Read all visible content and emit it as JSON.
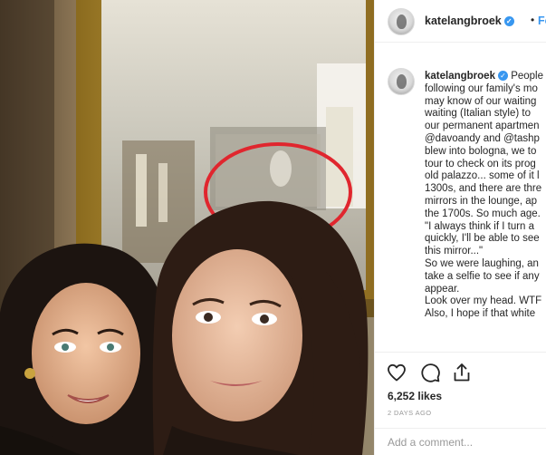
{
  "post": {
    "username": "katelangbroek",
    "follow_label": "Follo",
    "header_separator": "•",
    "verified_glyph": "✓",
    "caption_lines": [
      "People",
      "following our family's mo",
      "may know of our waiting",
      "waiting (Italian style) to",
      "our permanent apartmen",
      "@davoandy and @tashp",
      "blew into bologna, we to",
      "tour to check on its prog",
      "old palazzo... some of it l",
      "1300s, and there are thre",
      "mirrors in the lounge, ap",
      "the 1700s. So much age.",
      "\"I always think if I turn a",
      "quickly, I'll be able to see",
      "this mirror...\"",
      "So we were laughing, an",
      "take a selfie to see if any",
      "appear.",
      "Look over my head. WTF",
      "Also, I hope if that white"
    ],
    "likes": "6,252 likes",
    "time_ago": "2 DAYS AGO",
    "comment_placeholder": "Add a comment..."
  },
  "icons": {
    "like": "heart-icon",
    "comment": "comment-icon",
    "share": "share-icon",
    "verified": "verified-badge-icon"
  },
  "colors": {
    "accent": "#3897f0",
    "text": "#262626",
    "muted": "#999999",
    "highlight_ring": "#e0262e"
  }
}
